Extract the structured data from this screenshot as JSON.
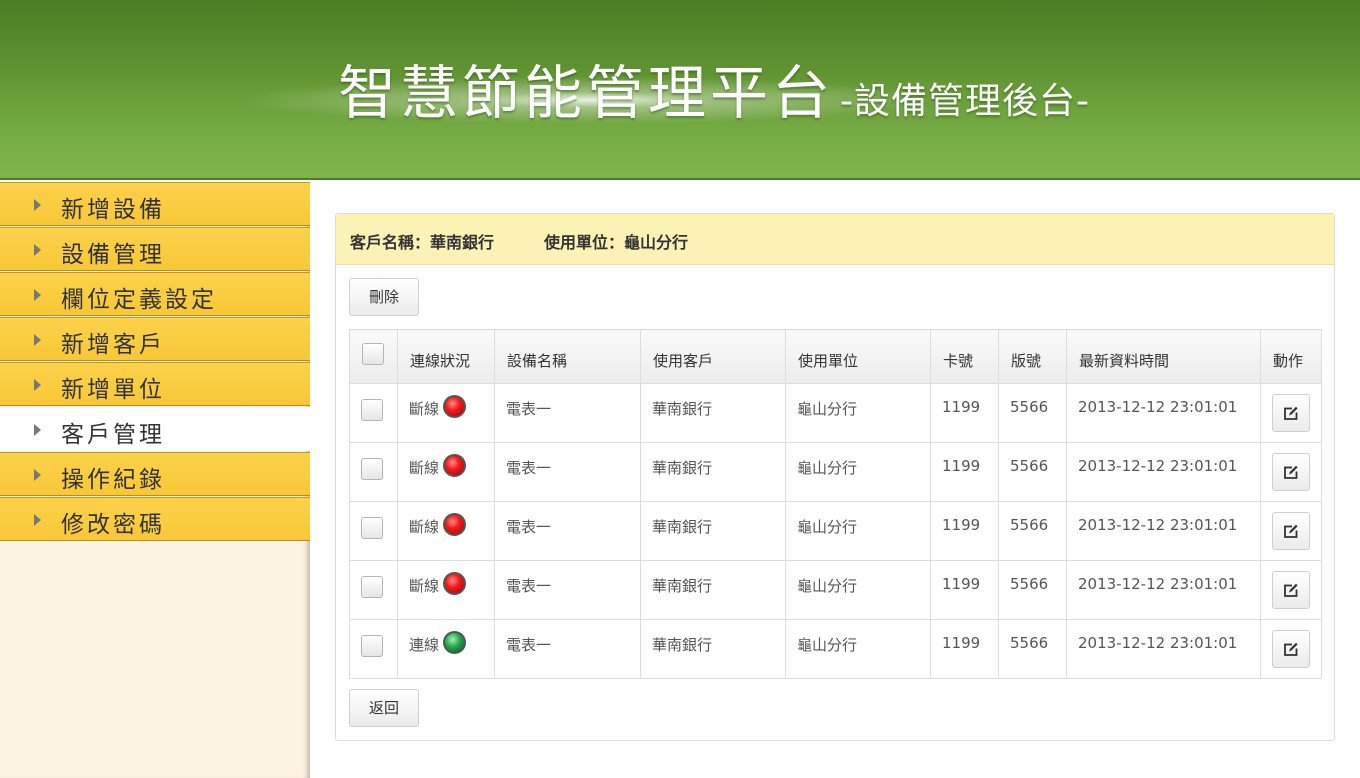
{
  "header": {
    "title": "智慧節能管理平台",
    "subtitle": "-設備管理後台-"
  },
  "sidebar": {
    "items": [
      {
        "label": "新增設備",
        "active": false
      },
      {
        "label": "設備管理",
        "active": false
      },
      {
        "label": "欄位定義設定",
        "active": false
      },
      {
        "label": "新增客戶",
        "active": false
      },
      {
        "label": "新增單位",
        "active": false
      },
      {
        "label": "客戶管理",
        "active": true
      },
      {
        "label": "操作紀錄",
        "active": false
      },
      {
        "label": "修改密碼",
        "active": false
      }
    ]
  },
  "panel": {
    "customer": "客戶名稱：華南銀行",
    "unit": "使用單位：龜山分行",
    "delete_label": "刪除",
    "back_label": "返回"
  },
  "table": {
    "headers": [
      "連線狀況",
      "設備名稱",
      "使用客戶",
      "使用單位",
      "卡號",
      "版號",
      "最新資料時間",
      "動作"
    ],
    "rows": [
      {
        "status": "斷線",
        "led": "red",
        "device": "電表一",
        "customer": "華南銀行",
        "unit": "龜山分行",
        "card": "1199",
        "version": "5566",
        "time": "2013-12-12 23:01:01"
      },
      {
        "status": "斷線",
        "led": "red",
        "device": "電表一",
        "customer": "華南銀行",
        "unit": "龜山分行",
        "card": "1199",
        "version": "5566",
        "time": "2013-12-12 23:01:01"
      },
      {
        "status": "斷線",
        "led": "red",
        "device": "電表一",
        "customer": "華南銀行",
        "unit": "龜山分行",
        "card": "1199",
        "version": "5566",
        "time": "2013-12-12 23:01:01"
      },
      {
        "status": "斷線",
        "led": "red",
        "device": "電表一",
        "customer": "華南銀行",
        "unit": "龜山分行",
        "card": "1199",
        "version": "5566",
        "time": "2013-12-12 23:01:01"
      },
      {
        "status": "連線",
        "led": "green",
        "device": "電表一",
        "customer": "華南銀行",
        "unit": "龜山分行",
        "card": "1199",
        "version": "5566",
        "time": "2013-12-12 23:01:01"
      }
    ]
  },
  "colors": {
    "header_green": "#5d9130",
    "nav_yellow": "#f8c737",
    "panel_head": "#fdf2b6",
    "led_offline": "#f21b1b",
    "led_online": "#1fa64a"
  },
  "icons": {
    "nav_arrow": "triangle-right-icon",
    "edit": "edit-icon",
    "status_led": "status-led-icon"
  }
}
